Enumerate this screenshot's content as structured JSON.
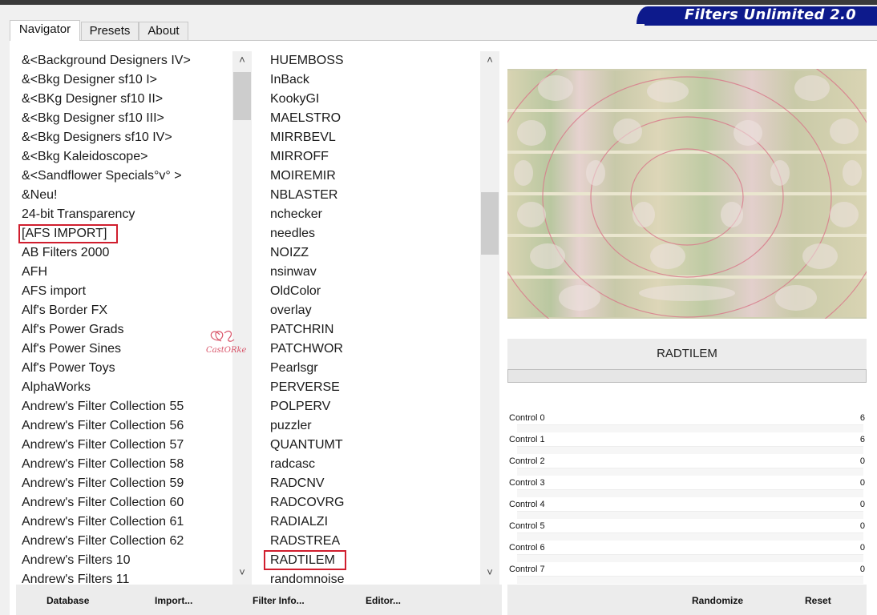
{
  "app_title": "Filters Unlimited 2.0",
  "tabs": [
    "Navigator",
    "Presets",
    "About"
  ],
  "categories": [
    "&<Background Designers IV>",
    "&<Bkg Designer sf10 I>",
    "&<BKg Designer sf10 II>",
    "&<Bkg Designer sf10 III>",
    "&<Bkg Designers sf10 IV>",
    "&<Bkg Kaleidoscope>",
    "&<Sandflower Specials°v° >",
    "&Neu!",
    "24-bit Transparency",
    "[AFS IMPORT]",
    "AB Filters 2000",
    "AFH",
    "AFS import",
    "Alf's Border FX",
    "Alf's Power Grads",
    "Alf's Power Sines",
    "Alf's Power Toys",
    "AlphaWorks",
    "Andrew's Filter Collection 55",
    "Andrew's Filter Collection 56",
    "Andrew's Filter Collection 57",
    "Andrew's Filter Collection 58",
    "Andrew's Filter Collection 59",
    "Andrew's Filter Collection 60",
    "Andrew's Filter Collection 61",
    "Andrew's Filter Collection 62",
    "Andrew's Filters 10",
    "Andrew's Filters 11"
  ],
  "selected_category": "[AFS IMPORT]",
  "filters": [
    "HUEMBOSS",
    "InBack",
    "KookyGI",
    "MAELSTRO",
    "MIRRBEVL",
    "MIRROFF",
    "MOIREMIR",
    "NBLASTER",
    "nchecker",
    "needles",
    "NOIZZ",
    "nsinwav",
    "OldColor",
    "overlay",
    "PATCHRIN",
    "PATCHWOR",
    "Pearlsgr",
    "PERVERSE",
    "POLPERV",
    "puzzler",
    "QUANTUMT",
    "radcasc",
    "RADCNV",
    "RADCOVRG",
    "RADIALZI",
    "RADSTREA",
    "RADTILEM",
    "randomnoise"
  ],
  "selected_filter": "RADTILEM",
  "current_filter_name": "RADTILEM",
  "watermark_text": "CastORke",
  "controls": [
    {
      "label": "Control 0",
      "value": "6"
    },
    {
      "label": "Control 1",
      "value": "6"
    },
    {
      "label": "Control 2",
      "value": "0"
    },
    {
      "label": "Control 3",
      "value": "0"
    },
    {
      "label": "Control 4",
      "value": "0"
    },
    {
      "label": "Control 5",
      "value": "0"
    },
    {
      "label": "Control 6",
      "value": "0"
    },
    {
      "label": "Control 7",
      "value": "0"
    }
  ],
  "buttons": {
    "database": "Database",
    "import": "Import...",
    "filter_info": "Filter Info...",
    "editor": "Editor...",
    "randomize": "Randomize",
    "reset": "Reset"
  },
  "colors": {
    "brand_blue": "#0d1a8c",
    "selection_red": "#d01e2e"
  }
}
